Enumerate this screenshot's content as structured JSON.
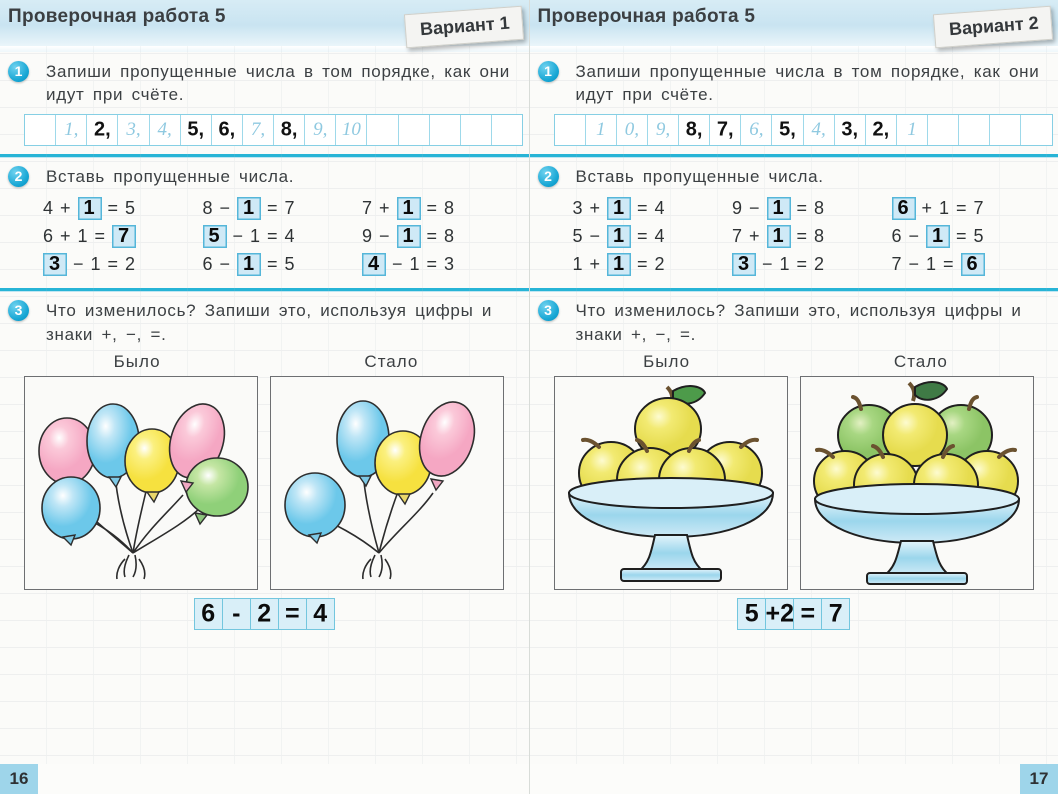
{
  "spread": {
    "left_page_number": "16",
    "right_page_number": "17"
  },
  "left": {
    "header": {
      "title": "Проверочная работа 5",
      "variant": "Вариант 1"
    },
    "task1": {
      "number": "1",
      "text": "Запиши пропущенные числа в том порядке, как они идут при счёте.",
      "cells": [
        {
          "value": "",
          "style": "empty"
        },
        {
          "value": "1,",
          "style": "pale"
        },
        {
          "value": "2,",
          "style": "filled"
        },
        {
          "value": "3,",
          "style": "pale"
        },
        {
          "value": "4,",
          "style": "pale"
        },
        {
          "value": "5,",
          "style": "filled"
        },
        {
          "value": "6,",
          "style": "filled"
        },
        {
          "value": "7,",
          "style": "pale"
        },
        {
          "value": "8,",
          "style": "filled"
        },
        {
          "value": "9,",
          "style": "pale"
        },
        {
          "value": "10",
          "style": "pale"
        },
        {
          "value": "",
          "style": "empty"
        },
        {
          "value": "",
          "style": "empty"
        },
        {
          "value": "",
          "style": "empty"
        },
        {
          "value": "",
          "style": "empty"
        },
        {
          "value": "",
          "style": "empty"
        }
      ]
    },
    "task2": {
      "number": "2",
      "text": "Вставь пропущенные числа.",
      "rows": [
        [
          {
            "parts": [
              "4",
              "+",
              "BLANK:1",
              "=",
              "5"
            ]
          },
          {
            "parts": [
              "8",
              "−",
              "BLANK:1",
              "=",
              "7"
            ]
          },
          {
            "parts": [
              "7",
              "+",
              "BLANK:1",
              "=",
              "8"
            ]
          }
        ],
        [
          {
            "parts": [
              "6",
              "+",
              "1",
              "=",
              "BLANK:7"
            ]
          },
          {
            "parts": [
              "BLANK:5",
              "−",
              "1",
              "=",
              "4"
            ]
          },
          {
            "parts": [
              "9",
              "−",
              "BLANK:1",
              "=",
              "8"
            ]
          }
        ],
        [
          {
            "parts": [
              "BLANK:3",
              "−",
              "1",
              "=",
              "2"
            ]
          },
          {
            "parts": [
              "6",
              "−",
              "BLANK:1",
              "=",
              "5"
            ]
          },
          {
            "parts": [
              "BLANK:4",
              "−",
              "1",
              "=",
              "3"
            ]
          }
        ]
      ]
    },
    "task3": {
      "number": "3",
      "text": "Что изменилось? Запиши это, используя цифры и знаки +, −, =.",
      "caption_before": "Было",
      "caption_after": "Стало",
      "before_items": [
        "pink-balloon",
        "blue-balloon",
        "blue-balloon",
        "yellow-balloon",
        "pink-balloon",
        "green-balloon"
      ],
      "after_items": [
        "blue-balloon",
        "blue-balloon",
        "yellow-balloon",
        "pink-balloon"
      ],
      "answer_cells": [
        "6",
        "-",
        "2",
        "=",
        "4"
      ]
    }
  },
  "right": {
    "header": {
      "title": "Проверочная работа 5",
      "variant": "Вариант 2"
    },
    "task1": {
      "number": "1",
      "text": "Запиши пропущенные числа в том порядке, как они идут при счёте.",
      "cells": [
        {
          "value": "",
          "style": "empty"
        },
        {
          "value": "1",
          "style": "pale"
        },
        {
          "value": "0,",
          "style": "pale"
        },
        {
          "value": "9,",
          "style": "pale"
        },
        {
          "value": "8,",
          "style": "filled"
        },
        {
          "value": "7,",
          "style": "filled"
        },
        {
          "value": "6,",
          "style": "pale"
        },
        {
          "value": "5,",
          "style": "filled"
        },
        {
          "value": "4,",
          "style": "pale"
        },
        {
          "value": "3,",
          "style": "filled"
        },
        {
          "value": "2,",
          "style": "filled"
        },
        {
          "value": "1",
          "style": "pale"
        },
        {
          "value": "",
          "style": "empty"
        },
        {
          "value": "",
          "style": "empty"
        },
        {
          "value": "",
          "style": "empty"
        },
        {
          "value": "",
          "style": "empty"
        }
      ]
    },
    "task2": {
      "number": "2",
      "text": "Вставь пропущенные числа.",
      "rows": [
        [
          {
            "parts": [
              "3",
              "+",
              "BLANK:1",
              "=",
              "4"
            ]
          },
          {
            "parts": [
              "9",
              "−",
              "BLANK:1",
              "=",
              "8"
            ]
          },
          {
            "parts": [
              "BLANK:6",
              "+",
              "1",
              "=",
              "7"
            ]
          }
        ],
        [
          {
            "parts": [
              "5",
              "−",
              "BLANK:1",
              "=",
              "4"
            ]
          },
          {
            "parts": [
              "7",
              "+",
              "BLANK:1",
              "=",
              "8"
            ]
          },
          {
            "parts": [
              "6",
              "−",
              "BLANK:1",
              "=",
              "5"
            ]
          }
        ],
        [
          {
            "parts": [
              "1",
              "+",
              "BLANK:1",
              "=",
              "2"
            ]
          },
          {
            "parts": [
              "BLANK:3",
              "−",
              "1",
              "=",
              "2"
            ]
          },
          {
            "parts": [
              "7",
              "−",
              "1",
              "=",
              "BLANK:6"
            ]
          }
        ]
      ]
    },
    "task3": {
      "number": "3",
      "text": "Что изменилось? Запиши это, используя цифры и знаки +, −, =.",
      "caption_before": "Было",
      "caption_after": "Стало",
      "before_items": [
        "yellow-apple",
        "yellow-apple",
        "yellow-apple",
        "yellow-apple",
        "yellow-apple"
      ],
      "after_items": [
        "yellow-apple",
        "yellow-apple",
        "yellow-apple",
        "yellow-apple",
        "green-apple",
        "yellow-apple",
        "green-apple"
      ],
      "answer_cells": [
        "5",
        "+2",
        "=",
        "7"
      ]
    }
  },
  "colors": {
    "accent_blue": "#27b4d6",
    "header_bg": "#cfe7f2",
    "blank_fill": "#cfe9f6",
    "pale_ink": "#8fc9e0"
  }
}
